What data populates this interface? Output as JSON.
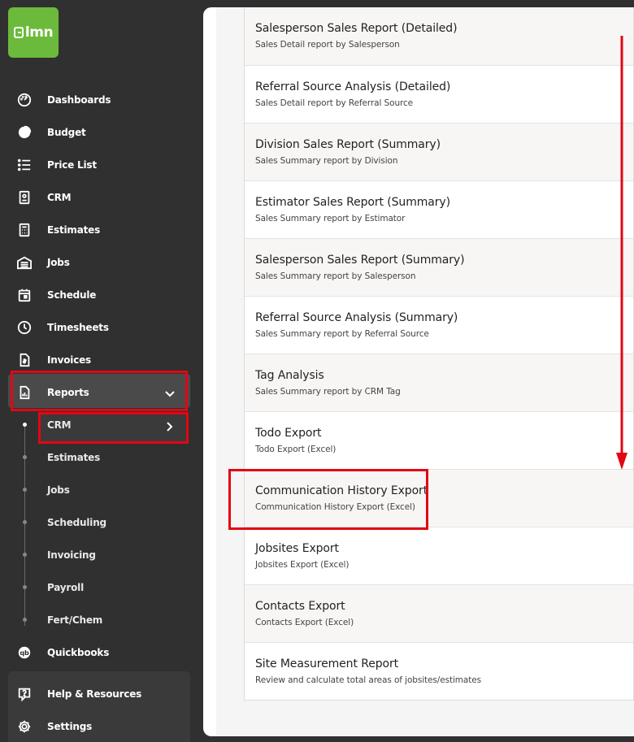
{
  "logo": {
    "text": "lmn"
  },
  "nav": {
    "items": [
      {
        "label": "Dashboards",
        "icon": "dashboard-icon"
      },
      {
        "label": "Budget",
        "icon": "pie-chart-icon"
      },
      {
        "label": "Price List",
        "icon": "list-icon"
      },
      {
        "label": "CRM",
        "icon": "contact-card-icon"
      },
      {
        "label": "Estimates",
        "icon": "calculator-icon"
      },
      {
        "label": "Jobs",
        "icon": "garage-icon"
      },
      {
        "label": "Schedule",
        "icon": "calendar-icon"
      },
      {
        "label": "Timesheets",
        "icon": "clock-icon"
      },
      {
        "label": "Invoices",
        "icon": "invoice-icon"
      },
      {
        "label": "Reports",
        "icon": "report-icon"
      }
    ],
    "sub_items": [
      {
        "label": "CRM"
      },
      {
        "label": "Estimates"
      },
      {
        "label": "Jobs"
      },
      {
        "label": "Scheduling"
      },
      {
        "label": "Invoicing"
      },
      {
        "label": "Payroll"
      },
      {
        "label": "Fert/Chem"
      }
    ],
    "after_items": [
      {
        "label": "Quickbooks",
        "icon": "quickbooks-icon"
      }
    ],
    "bottom_items": [
      {
        "label": "Help & Resources",
        "icon": "help-icon"
      },
      {
        "label": "Settings",
        "icon": "gear-icon"
      }
    ]
  },
  "reports": [
    {
      "title": "Salesperson Sales Report (Detailed)",
      "desc": "Sales Detail report by Salesperson"
    },
    {
      "title": "Referral Source Analysis (Detailed)",
      "desc": "Sales Detail report by Referral Source"
    },
    {
      "title": "Division Sales Report (Summary)",
      "desc": "Sales Summary report by Division"
    },
    {
      "title": "Estimator Sales Report (Summary)",
      "desc": "Sales Summary report by Estimator"
    },
    {
      "title": "Salesperson Sales Report (Summary)",
      "desc": "Sales Summary report by Salesperson"
    },
    {
      "title": "Referral Source Analysis (Summary)",
      "desc": "Sales Summary report by Referral Source"
    },
    {
      "title": "Tag Analysis",
      "desc": "Sales Summary report by CRM Tag"
    },
    {
      "title": "Todo Export",
      "desc": "Todo Export (Excel)"
    },
    {
      "title": "Communication History Export",
      "desc": "Communication History Export (Excel)"
    },
    {
      "title": "Jobsites Export",
      "desc": "Jobsites Export (Excel)"
    },
    {
      "title": "Contacts Export",
      "desc": "Contacts Export (Excel)"
    },
    {
      "title": "Site Measurement Report",
      "desc": "Review and calculate total areas of jobsites/estimates"
    }
  ],
  "colors": {
    "brand_green": "#6cba3c",
    "highlight_red": "#e30613",
    "sidebar_bg": "#303030"
  }
}
